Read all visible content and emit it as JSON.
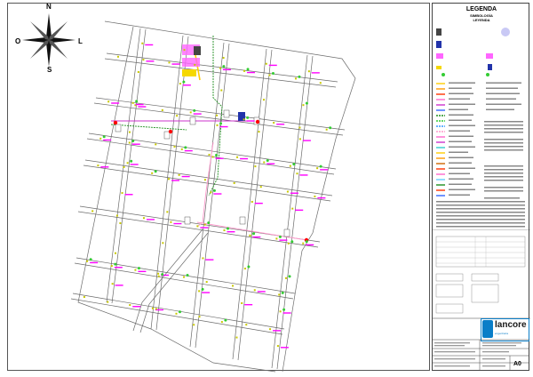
{
  "compass": {
    "n": "N",
    "s": "S",
    "o": "O",
    "l": "L"
  },
  "legend": {
    "title": "LEGENDA",
    "subtitle1": "SIMBOLOGÍA",
    "subtitle2": "LEYENDA"
  },
  "logo": {
    "name": "lancore",
    "tagline": "engenharia"
  },
  "sheet_number": "A0",
  "colors": {
    "street": "#6b6b6b",
    "pole": "#c8c800",
    "tree": "#33cc33",
    "label": "#ff00ff",
    "conduit_magenta": "#cc33cc",
    "conduit_green": "#1f8f1f",
    "highlight_yellow": "#ffcc00",
    "pink_route": "#ff99cc",
    "red_marker": "#ff0000",
    "logo_blue": "#0a7ec8"
  }
}
